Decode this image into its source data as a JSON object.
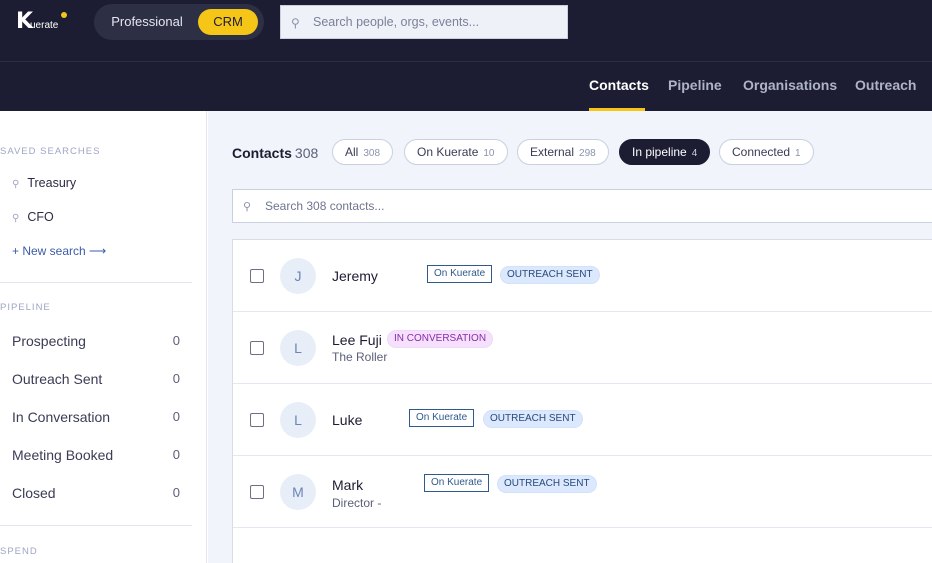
{
  "app": {
    "logo_mark": "K",
    "logo_text": "uerate",
    "modes": {
      "professional": "Professional",
      "crm": "CRM"
    },
    "global_search_placeholder": "Search people, orgs, events..."
  },
  "nav": {
    "contacts": "Contacts",
    "pipeline": "Pipeline",
    "organisations": "Organisations",
    "outreach": "Outreach"
  },
  "sidebar": {
    "saved_heading": "SAVED SEARCHES",
    "saved": [
      "Treasury",
      "CFO"
    ],
    "new_search": "+ New search ⟶",
    "pipeline_heading": "PIPELINE",
    "stages": [
      {
        "name": "Prospecting",
        "count": "0"
      },
      {
        "name": "Outreach Sent",
        "count": "0"
      },
      {
        "name": "In Conversation",
        "count": "0"
      },
      {
        "name": "Meeting Booked",
        "count": "0"
      },
      {
        "name": "Closed",
        "count": "0"
      }
    ],
    "spend_heading": "SPEND"
  },
  "main": {
    "title": "Contacts",
    "total": "308",
    "filters": [
      {
        "label": "All",
        "count": "308"
      },
      {
        "label": "On Kuerate",
        "count": "10"
      },
      {
        "label": "External",
        "count": "298"
      },
      {
        "label": "In pipeline",
        "count": "4"
      },
      {
        "label": "Connected",
        "count": "1"
      }
    ],
    "active_filter": "In pipeline",
    "search_placeholder": "Search 308 contacts...",
    "contacts": [
      {
        "initial": "J",
        "name": "Jeremy",
        "subtitle": "",
        "tags": [
          "On Kuerate",
          "OUTREACH SENT"
        ]
      },
      {
        "initial": "L",
        "name": "Lee Fuji",
        "subtitle": "The Roller",
        "tags": [
          "IN CONVERSATION"
        ]
      },
      {
        "initial": "L",
        "name": "Luke",
        "subtitle": "",
        "tags": [
          "On Kuerate",
          "OUTREACH SENT"
        ]
      },
      {
        "initial": "M",
        "name": "Mark",
        "subtitle": "Director -",
        "tags": [
          "On Kuerate",
          "OUTREACH SENT"
        ]
      }
    ]
  },
  "colors": {
    "navy": "#1c1d33",
    "accent_yellow": "#f5c518",
    "main_bg": "#f1f5fb",
    "outreach_tag_bg": "#dbe8fd",
    "conversation_tag_bg": "#f5e1fd",
    "link_blue": "#3b5ca8"
  },
  "icons": {
    "search": "search-icon",
    "saved_search": "saved-search-icon",
    "checkbox": "checkbox"
  }
}
